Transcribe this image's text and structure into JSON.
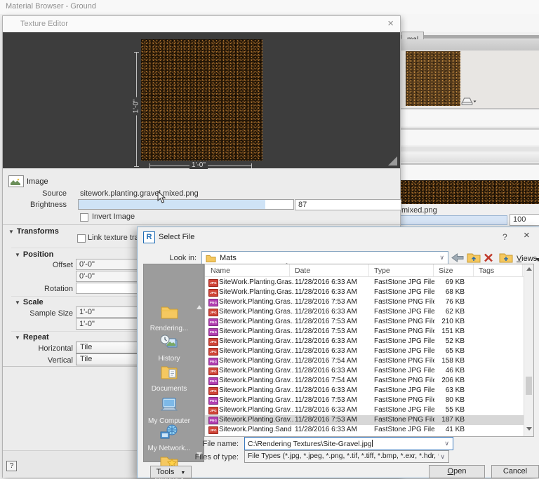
{
  "icons": {
    "close": "×",
    "help": "?",
    "chevron": "∨",
    "menu_arrow": "▼",
    "sort": "ˆ"
  },
  "background": {
    "window_title": "Material Browser - Ground",
    "tab_label": "mal",
    "texture_filename": "mixed.png",
    "slider_value": "100"
  },
  "texture_editor": {
    "title": "Texture Editor",
    "preview": {
      "dim_vertical": "1'-0\"",
      "dim_horizontal": "1'-0\""
    },
    "image_section": {
      "header": "Image",
      "source_label": "Source",
      "source_value": "sitework.planting.gravel.mixed.png",
      "brightness_label": "Brightness",
      "brightness_value": "87",
      "invert_label": "Invert Image"
    },
    "transforms": {
      "header": "Transforms",
      "link_label": "Link texture transf",
      "position_header": "Position",
      "offset_label": "Offset",
      "offset_x": "0'-0\"",
      "offset_y": "0'-0\"",
      "rotation_label": "Rotation",
      "rotation_value": "",
      "scale_header": "Scale",
      "sample_size_label": "Sample Size",
      "sample_x": "1'-0\"",
      "sample_y": "1'-0\"",
      "repeat_header": "Repeat",
      "horizontal_label": "Horizontal",
      "horizontal_value": "Tile",
      "vertical_label": "Vertical",
      "vertical_value": "Tile"
    },
    "help_label": "?"
  },
  "select_file": {
    "title": "Select File",
    "look_in_label": "Look in:",
    "look_in_value": "Mats",
    "views_label": "Views",
    "places": [
      {
        "icon": "folder",
        "label": "Rendering..."
      },
      {
        "icon": "history",
        "label": "History"
      },
      {
        "icon": "documents",
        "label": "Documents"
      },
      {
        "icon": "computer",
        "label": "My Computer"
      },
      {
        "icon": "network",
        "label": "My Network..."
      },
      {
        "icon": "favorites",
        "label": "Favorites"
      }
    ],
    "columns": [
      "Name",
      "Date",
      "Type",
      "Size",
      "Tags"
    ],
    "files": [
      {
        "icon": "jpg",
        "name": "SiteWork.Planting.Gras...",
        "date": "11/28/2016 6:33 AM",
        "type": "FastStone JPG File",
        "size": "69 KB",
        "selected": false
      },
      {
        "icon": "jpg",
        "name": "SiteWork.Planting.Gras...",
        "date": "11/28/2016 6:33 AM",
        "type": "FastStone JPG File",
        "size": "68 KB",
        "selected": false
      },
      {
        "icon": "png",
        "name": "Sitework.Planting.Gras...",
        "date": "11/28/2016 7:53 AM",
        "type": "FastStone PNG File",
        "size": "76 KB",
        "selected": false
      },
      {
        "icon": "jpg",
        "name": "Sitework.Planting.Gras...",
        "date": "11/28/2016 6:33 AM",
        "type": "FastStone JPG File",
        "size": "62 KB",
        "selected": false
      },
      {
        "icon": "png",
        "name": "Sitework.Planting.Gras...",
        "date": "11/28/2016 7:53 AM",
        "type": "FastStone PNG File",
        "size": "210 KB",
        "selected": false
      },
      {
        "icon": "png",
        "name": "Sitework.Planting.Gras...",
        "date": "11/28/2016 7:53 AM",
        "type": "FastStone PNG File",
        "size": "151 KB",
        "selected": false
      },
      {
        "icon": "jpg",
        "name": "Sitework.Planting.Grav...",
        "date": "11/28/2016 6:33 AM",
        "type": "FastStone JPG File",
        "size": "52 KB",
        "selected": false
      },
      {
        "icon": "jpg",
        "name": "Sitework.Planting.Grav...",
        "date": "11/28/2016 6:33 AM",
        "type": "FastStone JPG File",
        "size": "65 KB",
        "selected": false
      },
      {
        "icon": "png",
        "name": "Sitework.Planting.Grav...",
        "date": "11/28/2016 7:54 AM",
        "type": "FastStone PNG File",
        "size": "158 KB",
        "selected": false
      },
      {
        "icon": "jpg",
        "name": "Sitework.Planting.Grav...",
        "date": "11/28/2016 6:33 AM",
        "type": "FastStone JPG File",
        "size": "46 KB",
        "selected": false
      },
      {
        "icon": "png",
        "name": "Sitework.Planting.Grav...",
        "date": "11/28/2016 7:54 AM",
        "type": "FastStone PNG File",
        "size": "206 KB",
        "selected": false
      },
      {
        "icon": "jpg",
        "name": "Sitework.Planting.Grav...",
        "date": "11/28/2016 6:33 AM",
        "type": "FastStone JPG File",
        "size": "63 KB",
        "selected": false
      },
      {
        "icon": "png",
        "name": "Sitework.Planting.Grav...",
        "date": "11/28/2016 7:53 AM",
        "type": "FastStone PNG File",
        "size": "80 KB",
        "selected": false
      },
      {
        "icon": "jpg",
        "name": "Sitework.Planting.Grav...",
        "date": "11/28/2016 6:33 AM",
        "type": "FastStone JPG File",
        "size": "55 KB",
        "selected": false
      },
      {
        "icon": "png",
        "name": "Sitework.Planting.Grav...",
        "date": "11/28/2016 7:53 AM",
        "type": "FastStone PNG File",
        "size": "187 KB",
        "selected": true
      },
      {
        "icon": "jpg",
        "name": "Sitework.Planting.Sand",
        "date": "11/28/2016 6:33 AM",
        "type": "FastStone JPG File",
        "size": "41 KB",
        "selected": false
      }
    ],
    "file_name_label": "File name:",
    "file_name_value": "C:\\Rendering Textures\\Site-Gravel.jpg",
    "files_of_type_label": "Files of type:",
    "files_of_type_value": "File Types (*.jpg, *.jpeg, *.png, *.tif, *.tiff, *.bmp, *.exr, *.hdr, *.db, *.pc",
    "tools_label": "Tools",
    "open_label": "Open",
    "cancel_label": "Cancel"
  }
}
